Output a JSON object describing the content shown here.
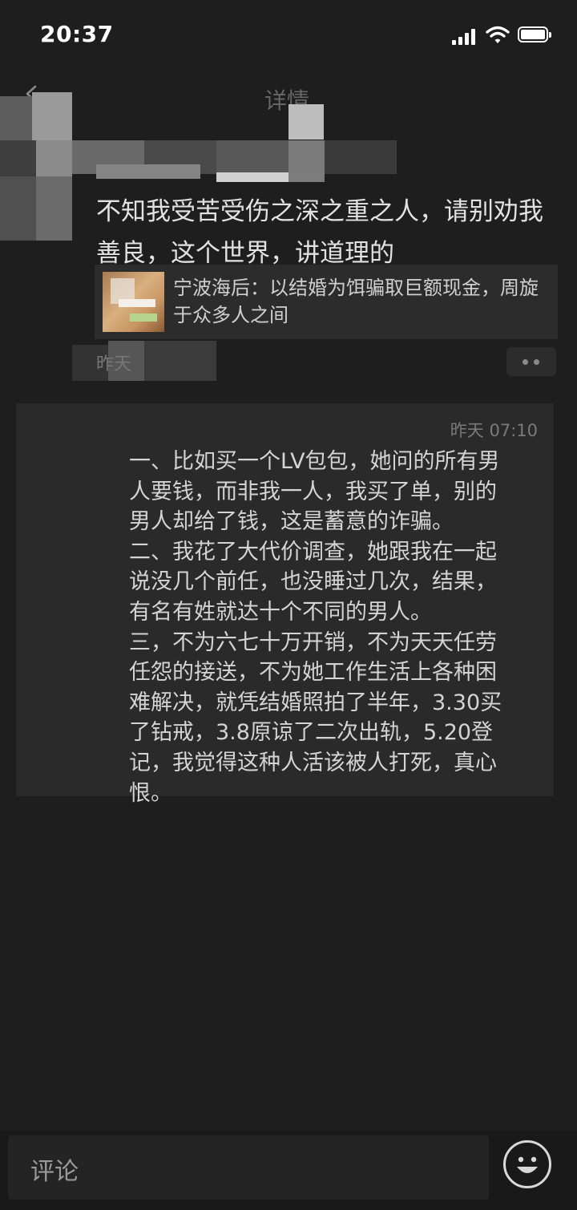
{
  "status_bar": {
    "time": "20:37"
  },
  "header": {
    "title": "详情"
  },
  "post": {
    "content": "不知我受苦受伤之深之重之人，请别劝我善良，这个世界，讲道理的",
    "link_title": "宁波海后：以结婚为饵骗取巨额现金，周旋于众多人之间",
    "time": "昨天"
  },
  "comment": {
    "time": "昨天 07:10",
    "lines": [
      "一、比如买一个LV包包，她问的所有男",
      "人要钱，而非我一人，我买了单，别的",
      "男人却给了钱，这是蓄意的诈骗。",
      "二、我花了大代价调查，她跟我在一起",
      "说没几个前任，也没睡过几次，结果，",
      "有名有姓就达十个不同的男人。",
      "三，不为六七十万开销，不为天天任劳",
      "任怨的接送，不为她工作生活上各种困",
      "难解决，就凭结婚照拍了半年，3.30买",
      "了钻戒，3.8原谅了二次出轨，5.20登",
      "记，我觉得这种人活该被人打死，真心",
      "恨。"
    ]
  },
  "bottom_bar": {
    "comment_placeholder": "评论",
    "emoji_icon": "smiley-icon"
  },
  "icons": {
    "back": "chevron-left-icon",
    "more": "more-dots-icon",
    "signal": "signal-icon",
    "wifi": "wifi-icon",
    "battery": "battery-icon"
  }
}
